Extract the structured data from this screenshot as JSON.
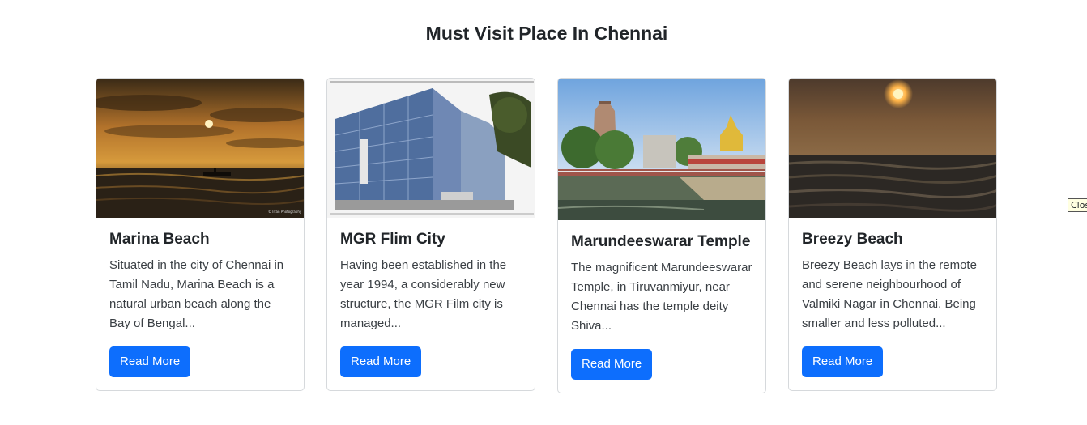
{
  "heading": "Must Visit Place In Chennai",
  "tooltip": "Clos",
  "cards": [
    {
      "title": "Marina Beach",
      "text": "Situated in the city of Chennai in Tamil Nadu, Marina Beach is a natural urban beach along the Bay of Bengal...",
      "button": "Read More",
      "image": "sunset-beach-with-boat-image",
      "watermark": "© Irfan Photography"
    },
    {
      "title": "MGR Flim City",
      "text": "Having been established in the year 1994, a considerably new structure, the MGR Film city is managed...",
      "button": "Read More",
      "image": "glass-office-building-image"
    },
    {
      "title": "Marundeeswarar Temple",
      "text": "The magnificent Marundeeswarar Temple, in Tiruvanmiyur, near Chennai has the temple deity Shiva...",
      "button": "Read More",
      "image": "temple-with-tank-image"
    },
    {
      "title": "Breezy Beach",
      "text": "Breezy Beach lays in the remote and serene neighbourhood of Valmiki Nagar in Chennai. Being smaller and less polluted...",
      "button": "Read More",
      "image": "orange-sunset-sea-image"
    }
  ],
  "colors": {
    "button": "#0d6efd",
    "border": "#d6d9dc"
  }
}
